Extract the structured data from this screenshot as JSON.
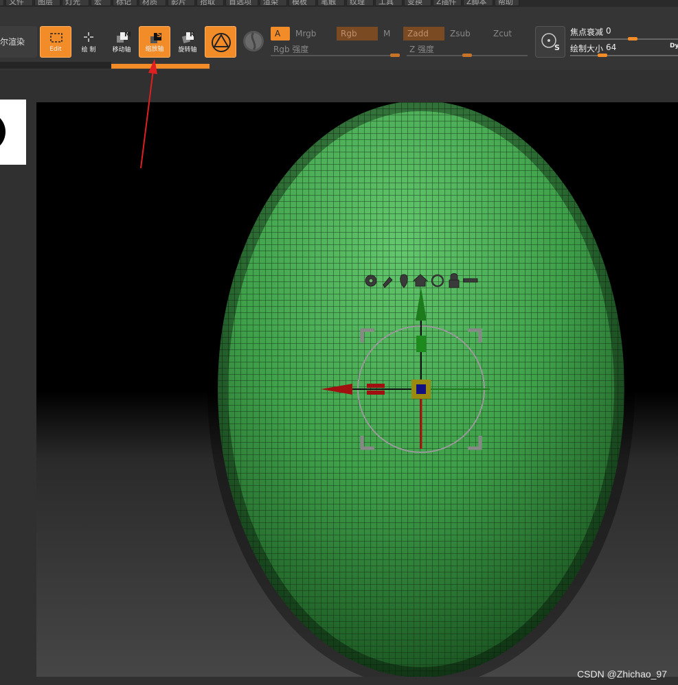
{
  "menu": {
    "items": [
      "",
      "文件",
      "图层",
      "灯光",
      "宏",
      "标记",
      "材质",
      "影片",
      "拾取",
      "首选项",
      "渲染",
      "模板",
      "笔触",
      "纹理",
      "工具",
      "变换",
      "Z插件",
      "Z脚本",
      "帮助"
    ]
  },
  "toolbar": {
    "render_label": "尔渲染",
    "edit_label": "Edit",
    "draw_label": "绘 制",
    "move_label": "移动轴",
    "scale_label": "缩放轴",
    "rotate_label": "旋转轴",
    "move_key": "M",
    "scale_key": "S",
    "rotate_key": "R",
    "a_label": "A",
    "mrgb_label": "Mrgb",
    "rgb_label": "Rgb",
    "m_label": "M",
    "zadd_label": "Zadd",
    "zsub_label": "Zsub",
    "zcut_label": "Zcut",
    "rgb_intensity_label": "Rgb 强度",
    "z_intensity_label": "Z 强度",
    "focal_shift_label": "焦点衰减",
    "focal_shift_value": "0",
    "draw_size_label": "绘制大小",
    "draw_size_value": "64",
    "dyn_label": "Dy",
    "lightbox_key": "S"
  },
  "colors": {
    "accent": "#f28c28",
    "mesh_green": "#4cbb5a",
    "annotation_arrow": "#e02020"
  },
  "icons": [
    "gear-icon",
    "pin-icon",
    "location-icon",
    "home-icon",
    "reset-icon",
    "lock-icon",
    "line-icon"
  ],
  "watermark": "CSDN @Zhichao_97"
}
